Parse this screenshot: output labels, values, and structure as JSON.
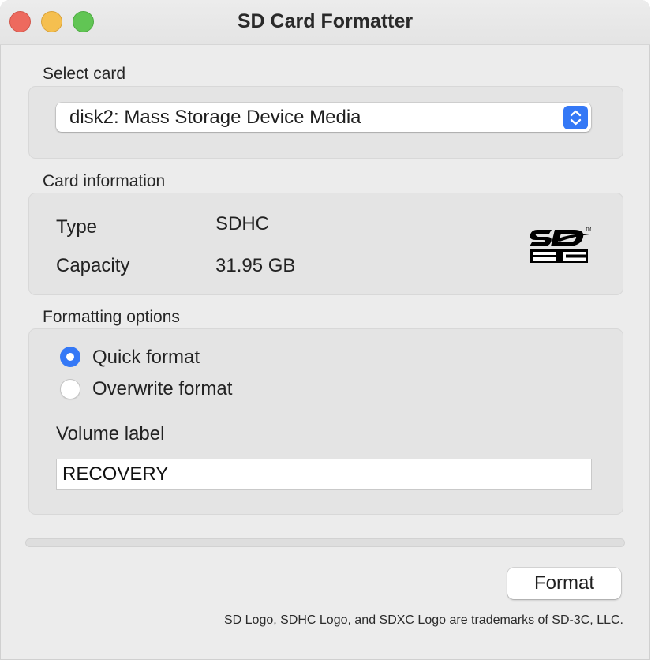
{
  "window": {
    "title": "SD Card Formatter"
  },
  "select_card": {
    "label": "Select card",
    "selected": "disk2: Mass Storage Device Media"
  },
  "card_info": {
    "label": "Card information",
    "type_key": "Type",
    "type_value": "SDHC",
    "capacity_key": "Capacity",
    "capacity_value": "31.95 GB",
    "logo_icon": "sdhc-logo-icon"
  },
  "formatting": {
    "label": "Formatting options",
    "quick_label": "Quick format",
    "overwrite_label": "Overwrite format",
    "selected_option": "Quick format",
    "volume_label_title": "Volume label",
    "volume_label_value": "RECOVERY"
  },
  "progress": {
    "value": 0
  },
  "actions": {
    "format_label": "Format"
  },
  "footer": {
    "trademark": "SD Logo, SDHC Logo, and SDXC Logo are trademarks of SD-3C, LLC."
  },
  "colors": {
    "accent": "#3478f6",
    "close": "#ed6a5e",
    "minimize": "#f5bf4f",
    "maximize": "#61c554"
  }
}
